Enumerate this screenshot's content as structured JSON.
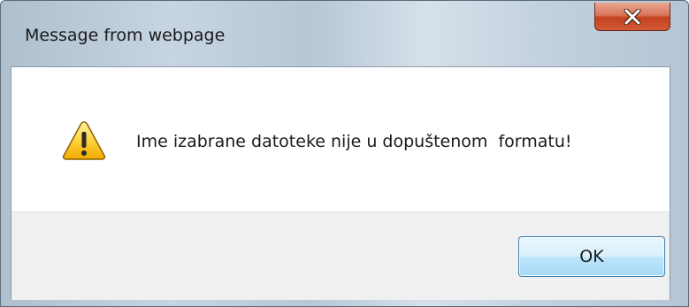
{
  "dialog": {
    "title": "Message from webpage",
    "close_icon": "close-icon",
    "warning_icon": "warning-icon",
    "message": "Ime izabrane datoteke nije u dopuštenom  formatu!",
    "ok_label": "OK"
  },
  "colors": {
    "close_button": "#c7502c",
    "ok_button_border": "#3c7fb1",
    "footer_background": "#f0f0f0"
  }
}
